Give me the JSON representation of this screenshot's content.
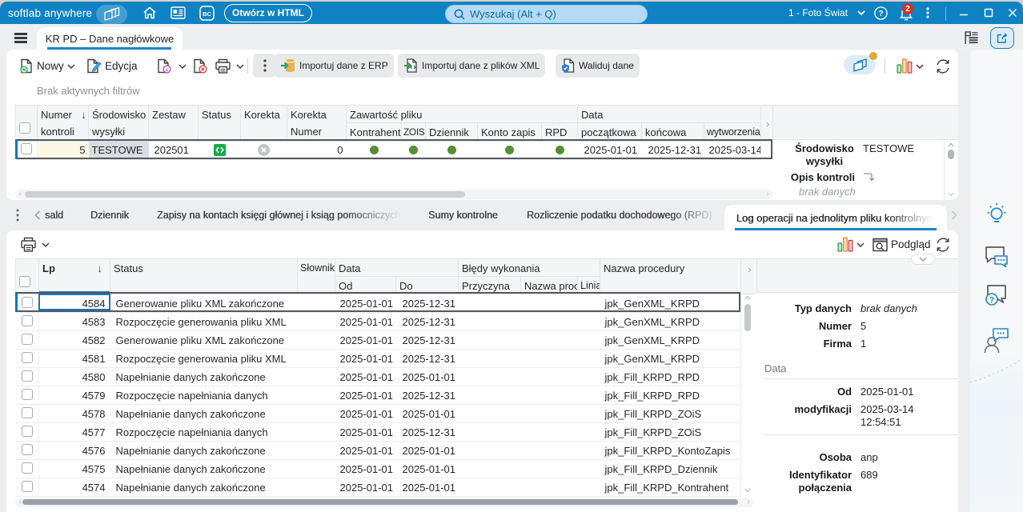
{
  "titlebar": {
    "brand": "softlab anywhere",
    "open_html_label": "Otwórz w HTML",
    "search_placeholder": "Wyszukaj (Alt + Q)",
    "company": "1 - Foto Świat",
    "notification_count": "2"
  },
  "tabs": {
    "main_tab": "KR PD – Dane nagłówkowe"
  },
  "toolbar": {
    "new_label": "Nowy",
    "edit_label": "Edycja",
    "import_erp_label": "Importuj dane z ERP",
    "import_xml_label": "Importuj dane z plików XML",
    "validate_label": "Waliduj dane",
    "no_filters": "Brak aktywnych filtrów"
  },
  "grid_top": {
    "headers": {
      "numer_kontroli": "Numer kontroli",
      "srodowisko_wysylki": "Środowisko wysyłki",
      "zestaw": "Zestaw",
      "status": "Status",
      "korekta": "Korekta",
      "korekta_numer": "Korekta Numer",
      "zawartosc_pliku": "Zawartość pliku",
      "kontrahent": "Kontrahent",
      "zois": "ZOIS",
      "dziennik": "Dziennik",
      "konto_zapis": "Konto zapis",
      "rpd": "RPD",
      "data": "Data",
      "poczatkowa": "początkowa",
      "koncowa": "końcowa",
      "wytworzenia": "wytworzenia"
    },
    "row": {
      "numer": "5",
      "srodowisko": "TESTOWE",
      "zestaw": "202501",
      "korekta_numer": "0",
      "poczatkowa": "2025-01-01",
      "koncowa": "2025-12-31",
      "wytworzenia": "2025-03-14"
    }
  },
  "detail_top": {
    "srodowisko_label": "Środowisko wysyłki",
    "srodowisko_value": "TESTOWE",
    "opis_label": "Opis kontroli",
    "empty_text": "brak danych"
  },
  "bottom_tabs": {
    "items": [
      "sald",
      "Dziennik",
      "Zapisy na kontach księgi głównej i ksiąg pomocniczych",
      "Sumy kontrolne",
      "Rozliczenie podatku dochodowego (RPD)"
    ],
    "active": "Log operacji na jednolitym pliku kontrolnym"
  },
  "toolbar2": {
    "preview_label": "Podgląd"
  },
  "grid_log": {
    "headers": {
      "lp": "Lp",
      "status": "Status",
      "slownik": "Słownik",
      "data": "Data",
      "od": "Od",
      "do": "Do",
      "bledy": "Błędy wykonania",
      "przyczyna": "Przyczyna",
      "nazwa_proc": "Nazwa proc",
      "linia": "Linia",
      "nazwa_procedury": "Nazwa procedury"
    },
    "rows": [
      {
        "lp": "4584",
        "status": "Generowanie pliku XML zakończone",
        "od": "2025-01-01",
        "do": "2025-12-31",
        "proc": "jpk_GenXML_KRPD"
      },
      {
        "lp": "4583",
        "status": "Rozpoczęcie generowania pliku XML",
        "od": "2025-01-01",
        "do": "2025-12-31",
        "proc": "jpk_GenXML_KRPD"
      },
      {
        "lp": "4582",
        "status": "Generowanie pliku XML zakończone",
        "od": "2025-01-01",
        "do": "2025-12-31",
        "proc": "jpk_GenXML_KRPD"
      },
      {
        "lp": "4581",
        "status": "Rozpoczęcie generowania pliku XML",
        "od": "2025-01-01",
        "do": "2025-12-31",
        "proc": "jpk_GenXML_KRPD"
      },
      {
        "lp": "4580",
        "status": "Napełnianie danych zakończone",
        "od": "2025-01-01",
        "do": "2025-01-01",
        "proc": "jpk_Fill_KRPD_RPD"
      },
      {
        "lp": "4579",
        "status": "Rozpoczęcie napełniania danych",
        "od": "2025-01-01",
        "do": "2025-12-31",
        "proc": "jpk_Fill_KRPD_RPD"
      },
      {
        "lp": "4578",
        "status": "Napełnianie danych zakończone",
        "od": "2025-01-01",
        "do": "2025-01-01",
        "proc": "jpk_Fill_KRPD_ZOiS"
      },
      {
        "lp": "4577",
        "status": "Rozpoczęcie napełniania danych",
        "od": "2025-01-01",
        "do": "2025-12-31",
        "proc": "jpk_Fill_KRPD_ZOiS"
      },
      {
        "lp": "4576",
        "status": "Napełnianie danych zakończone",
        "od": "2025-01-01",
        "do": "2025-01-01",
        "proc": "jpk_Fill_KRPD_KontoZapis"
      },
      {
        "lp": "4575",
        "status": "Napełnianie danych zakończone",
        "od": "2025-01-01",
        "do": "2025-01-01",
        "proc": "jpk_Fill_KRPD_Dziennik"
      },
      {
        "lp": "4574",
        "status": "Napełnianie danych zakończone",
        "od": "2025-01-01",
        "do": "2025-01-01",
        "proc": "jpk_Fill_KRPD_Kontrahent"
      }
    ]
  },
  "detail_log": {
    "typ_label": "Typ danych",
    "typ_value": "brak danych",
    "numer_label": "Numer",
    "numer_value": "5",
    "firma_label": "Firma",
    "firma_value": "1",
    "section_data": "Data",
    "od_label": "Od",
    "od_value": "2025-01-01",
    "mod_label": "modyfikacji",
    "mod_value": "2025-03-14 12:54:51",
    "osoba_label": "Osoba",
    "osoba_value": "anp",
    "id_label": "Identyfikator połączenia",
    "id_value": "689"
  },
  "colors": {
    "titlebar_blue": "#0f82c4",
    "accent_blue": "#1586c9",
    "status_green": "#17a94b",
    "dot_green": "#568f2f",
    "badge_red": "#d93025"
  }
}
